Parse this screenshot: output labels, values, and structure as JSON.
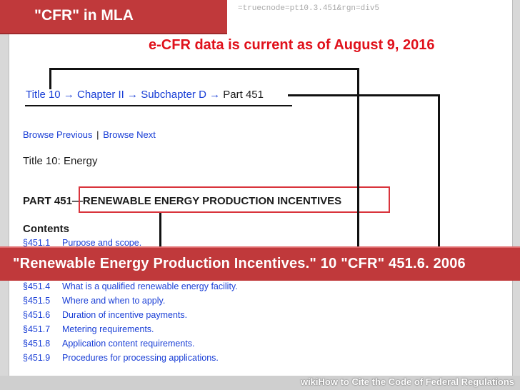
{
  "url_fragment": "=truecnode=pt10.3.451&rgn=div5",
  "overlay_title": "\"CFR\" in MLA",
  "currency_notice": "e-CFR data is current as of August 9, 2016",
  "breadcrumb": {
    "items": [
      "Title 10",
      "Chapter II",
      "Subchapter D"
    ],
    "current": "Part 451",
    "arrow": "→"
  },
  "browse": {
    "previous": "Browse Previous",
    "separator": "|",
    "next": "Browse Next"
  },
  "title_line": "Title 10: Energy",
  "part": {
    "prefix": "PART 451—",
    "name": "RENEWABLE ENERGY PRODUCTION INCENTIVES"
  },
  "contents_heading": "Contents",
  "toc": [
    {
      "num": "§451.1",
      "label": "Purpose and scope."
    },
    {
      "num": "§451.4",
      "label": "What is a qualified renewable energy facility."
    },
    {
      "num": "§451.5",
      "label": "Where and when to apply."
    },
    {
      "num": "§451.6",
      "label": "Duration of incentive payments."
    },
    {
      "num": "§451.7",
      "label": "Metering requirements."
    },
    {
      "num": "§451.8",
      "label": "Application content requirements."
    },
    {
      "num": "§451.9",
      "label": "Procedures for processing applications."
    }
  ],
  "citation_example": "\"Renewable Energy Production Incentives.\" 10 \"CFR\" 451.6. 2006",
  "watermark": {
    "brand": "wiki",
    "text": "How to Cite the Code of Federal Regulations"
  },
  "colors": {
    "banner": "#c0393b",
    "notice_red": "#e0111b",
    "link_blue": "#1a3fd6",
    "highlight_box": "#d9343c"
  }
}
